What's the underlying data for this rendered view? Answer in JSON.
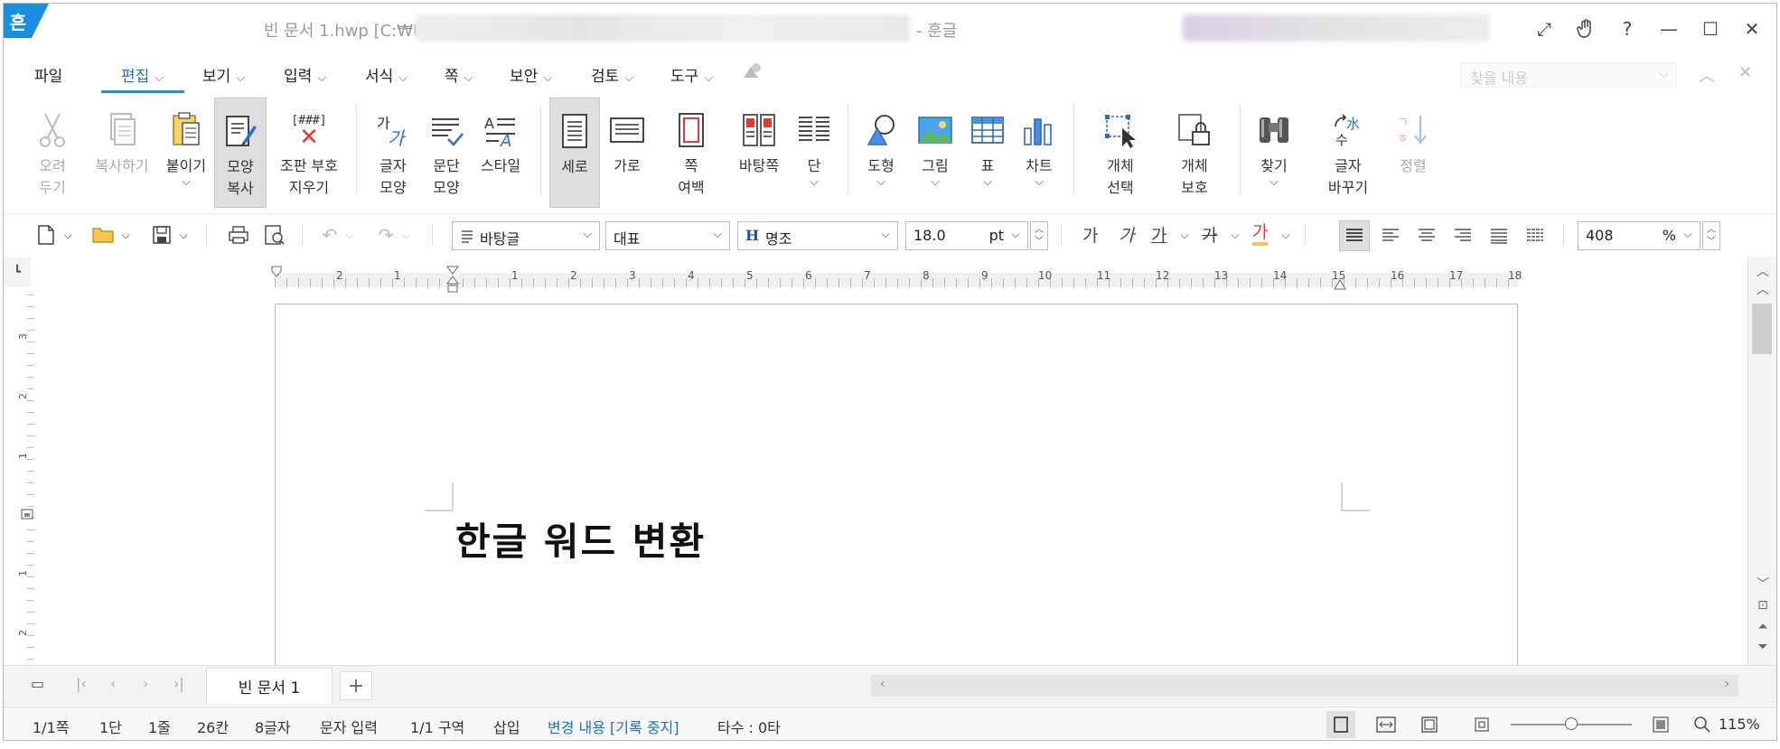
{
  "title_bar": {
    "logo": "흔",
    "doc_title": "빈 문서 1.hwp [C:₩U",
    "app_name": "- 훈글",
    "controls": [
      "expand-icon",
      "hand-icon",
      "help-icon",
      "minimize-icon",
      "maximize-icon",
      "close-icon"
    ]
  },
  "menu": {
    "items": [
      {
        "label": "파일",
        "dropdown": false
      },
      {
        "label": "편집",
        "dropdown": true,
        "active": true
      },
      {
        "label": "보기",
        "dropdown": true
      },
      {
        "label": "입력",
        "dropdown": true
      },
      {
        "label": "서식",
        "dropdown": true
      },
      {
        "label": "쪽",
        "dropdown": true
      },
      {
        "label": "보안",
        "dropdown": true
      },
      {
        "label": "검토",
        "dropdown": true
      },
      {
        "label": "도구",
        "dropdown": true
      }
    ],
    "search_placeholder": "찾을 내용"
  },
  "ribbon": {
    "cut": "오려\n두기",
    "copy": "복사하기",
    "paste": "붙이기",
    "format_copy": "모양\n복사",
    "clear_marks_top": "[###]",
    "clear_marks": "조판 부호\n지우기",
    "char_shape": "글자\n모양",
    "para_shape": "문단\n모양",
    "style": "스타일",
    "portrait": "세로",
    "landscape": "가로",
    "page_margin": "쪽\n여백",
    "master_page": "바탕쪽",
    "columns": "단",
    "shape": "도형",
    "picture": "그림",
    "table": "표",
    "chart": "차트",
    "select_object": "개체\n선택",
    "protect_object": "개체\n보호",
    "find": "찾기",
    "replace": "글자\n바꾸기",
    "sort": "정렬"
  },
  "toolbar": {
    "style_combo": "바탕글",
    "font_lang_combo": "대표",
    "font_combo": "명조",
    "font_size": "18.0",
    "size_unit": "pt",
    "zoom_value": "408",
    "zoom_unit": "%",
    "fmt_bold": "가",
    "fmt_italic": "가",
    "fmt_underline": "가",
    "fmt_strike": "가",
    "fmt_color": "가"
  },
  "ruler": {
    "h_numbers": [
      "2",
      "1",
      "1",
      "2",
      "3",
      "4",
      "5",
      "6",
      "7",
      "8",
      "9",
      "10",
      "11",
      "12",
      "13",
      "14",
      "15",
      "16",
      "17",
      "18"
    ],
    "v_numbers": [
      "3",
      "2",
      "1",
      "1",
      "2"
    ]
  },
  "document": {
    "text": "한글 워드 변환"
  },
  "tabs": {
    "doc_tab": "빈 문서 1",
    "add": "+"
  },
  "status": {
    "page": "1/1쪽",
    "column": "1단",
    "line": "1줄",
    "col_pos": "26칸",
    "chars": "8글자",
    "mode": "문자 입력",
    "section": "1/1 구역",
    "insert": "삽입",
    "track_changes": "변경 내용 [기록 중지]",
    "typing": "타수 : 0타",
    "zoom": "115%",
    "zoom_level": 0.5
  },
  "colors": {
    "accent": "#1a8fe0",
    "link_blue": "#1a73c8",
    "pressed_bg": "#dedede"
  }
}
